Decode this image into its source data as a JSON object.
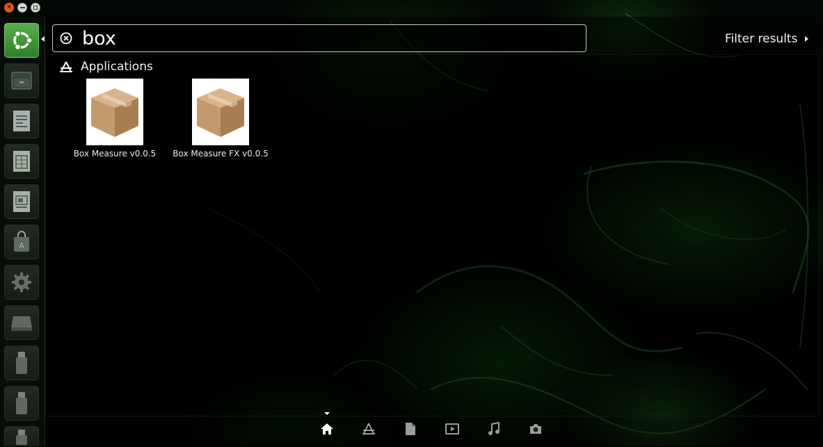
{
  "search": {
    "query": "box"
  },
  "filter": {
    "label": "Filter results"
  },
  "category": {
    "title": "Applications"
  },
  "results": [
    {
      "label": "Box Measure v0.0.5",
      "icon": "package-box-icon"
    },
    {
      "label": "Box Measure FX v0.0.5",
      "icon": "package-box-icon"
    }
  ],
  "launcher": [
    {
      "name": "dash-home",
      "icon": "ubuntu-logo-icon"
    },
    {
      "name": "files",
      "icon": "file-manager-icon"
    },
    {
      "name": "writer",
      "icon": "document-icon"
    },
    {
      "name": "calc",
      "icon": "spreadsheet-icon"
    },
    {
      "name": "impress",
      "icon": "presentation-icon"
    },
    {
      "name": "software-center",
      "icon": "shopping-bag-icon"
    },
    {
      "name": "system-settings",
      "icon": "gear-icon"
    },
    {
      "name": "disk",
      "icon": "drive-icon"
    },
    {
      "name": "usb-1",
      "icon": "usb-drive-icon"
    },
    {
      "name": "usb-2",
      "icon": "usb-drive-icon"
    },
    {
      "name": "usb-3",
      "icon": "usb-drive-icon"
    }
  ],
  "lenses": [
    {
      "name": "home",
      "icon": "home-icon",
      "active": true
    },
    {
      "name": "applications",
      "icon": "applications-icon",
      "active": false
    },
    {
      "name": "files",
      "icon": "file-icon",
      "active": false
    },
    {
      "name": "video",
      "icon": "video-icon",
      "active": false
    },
    {
      "name": "music",
      "icon": "music-icon",
      "active": false
    },
    {
      "name": "photos",
      "icon": "camera-icon",
      "active": false
    }
  ],
  "colors": {
    "launcher_home": "#4a9d3e",
    "window_close": "#e2532a"
  }
}
